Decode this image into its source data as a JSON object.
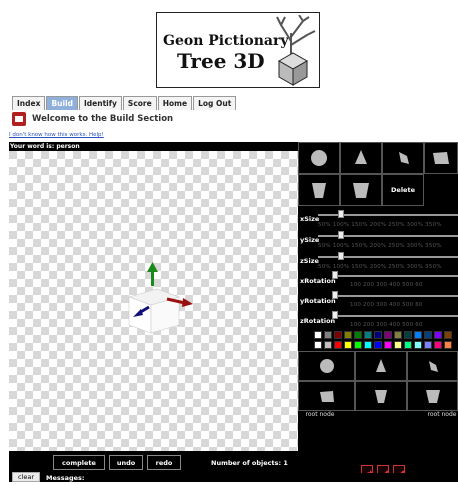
{
  "logo": {
    "line1": "Geon Pictionary",
    "line2": "Tree 3D"
  },
  "tabs": [
    {
      "label": "Index",
      "active": false
    },
    {
      "label": "Build",
      "active": true
    },
    {
      "label": "Identify",
      "active": false
    },
    {
      "label": "Score",
      "active": false
    },
    {
      "label": "Home",
      "active": false
    },
    {
      "label": "Log Out",
      "active": false
    }
  ],
  "section": {
    "title": "Welcome to the Build Section"
  },
  "help_link": "I don't know how this works. Help!",
  "word_label": "Your word is: person",
  "shape_palette": {
    "shapes": [
      "sphere-icon",
      "cone-icon",
      "wedge-icon",
      "trapezoid-icon",
      "cup-icon",
      "bucket-icon"
    ],
    "delete_label": "Delete"
  },
  "sliders": {
    "xsize": {
      "label": "xSize",
      "ticks": "50% 100% 150% 200% 250% 300% 350%"
    },
    "ysize": {
      "label": "ySize",
      "ticks": "50% 100% 150% 200% 250% 300% 350%"
    },
    "zsize": {
      "label": "zSize",
      "ticks": "50% 100% 150% 200% 250% 300% 350%"
    },
    "xrotation": {
      "label": "xRotation",
      "ticks": "100 200 300 400 500 60"
    },
    "yrotation": {
      "label": "yRotation",
      "ticks": "100 200 300 400 500 60"
    },
    "zrotation": {
      "label": "zRotation",
      "ticks": "100 200 300 400 500 60"
    }
  },
  "colors": {
    "row1": [
      "#ffffff",
      "#808080",
      "#800000",
      "#808000",
      "#008000",
      "#008080",
      "#000080",
      "#800080",
      "#808040",
      "#004040",
      "#0080ff",
      "#004080",
      "#8000ff",
      "#804000"
    ],
    "row2": [
      "#ffffff",
      "#c0c0c0",
      "#ff0000",
      "#ffff00",
      "#00ff00",
      "#00ffff",
      "#0000ff",
      "#ff00ff",
      "#ffff80",
      "#00ff80",
      "#80ffff",
      "#8080ff",
      "#ff0080",
      "#ff8040"
    ]
  },
  "tree_nodes": {
    "left": "root node",
    "right": "root node"
  },
  "buttons": {
    "complete": "complete",
    "undo": "undo",
    "redo": "redo",
    "clear": "clear"
  },
  "object_count": "Number of objects: 1",
  "messages_label": "Messages:"
}
